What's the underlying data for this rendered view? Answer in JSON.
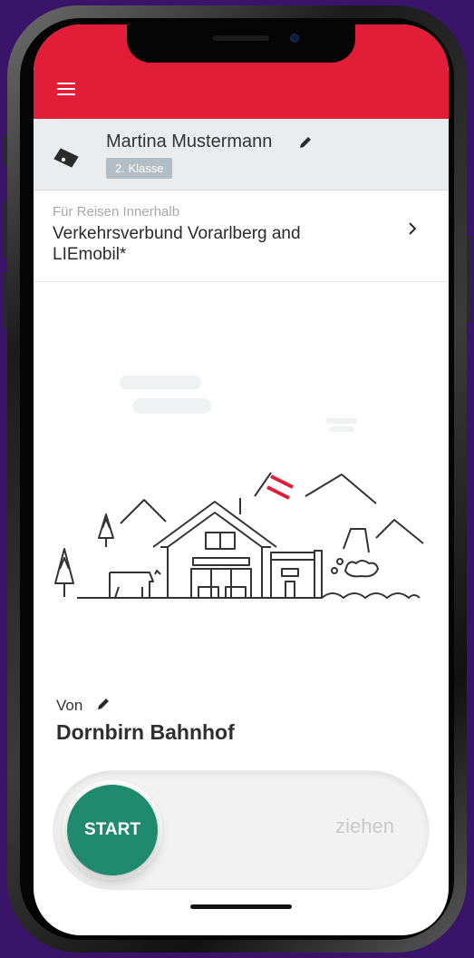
{
  "header": {
    "background": "#e21d38",
    "menu_icon": "hamburger-menu-icon"
  },
  "passenger": {
    "icon": "ticket-icon",
    "name": "Martina Mustermann",
    "edit_icon": "pencil-icon",
    "ticket_class": "2. Klasse"
  },
  "travel_zone": {
    "label": "Für Reisen Innerhalb",
    "name": "Verkehrsverbund Vorarlberg and LIEmobil*",
    "chevron_icon": "chevron-right-icon"
  },
  "illustration": {
    "name": "alpine-village-illustration"
  },
  "trip": {
    "from_label": "Von",
    "from_value": "Dornbirn Bahnhof",
    "edit_icon": "pencil-icon"
  },
  "slider": {
    "start_label": "START",
    "hint": "ziehen",
    "accent": "#1f8a6e"
  }
}
